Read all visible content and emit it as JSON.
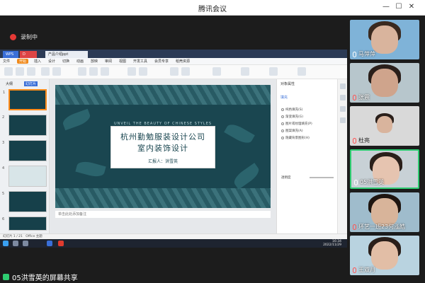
{
  "window": {
    "title": "腾讯会议",
    "minimize": "—",
    "maximize": "☐",
    "close": "✕"
  },
  "recording": {
    "label": "录制中",
    "color": "#e53935"
  },
  "shared_app": {
    "tabs": [
      "WPS",
      "D",
      "产品介绍ppt"
    ],
    "menu": [
      "文件",
      "开始",
      "插入",
      "设计",
      "切换",
      "动画",
      "放映",
      "审阅",
      "视图",
      "开发工具",
      "会员专享",
      "稻壳资源"
    ],
    "active_menu": "开始",
    "thumb_tabs": [
      "大纲",
      "幻灯片"
    ],
    "thumb_numbers": [
      "1",
      "2",
      "3",
      "4",
      "5",
      "6"
    ],
    "slide": {
      "subtitle": "UNVEIL THE BEAUTY OF CHINESE STYLES",
      "line1": "杭州勤勉服装设计公司",
      "line2": "室内装饰设计",
      "presenter": "汇报人：洪雪英"
    },
    "notes_placeholder": "单击此处添加备注",
    "right_panel": {
      "header": "对象属性",
      "tab": "填充",
      "options": [
        "纯色填充(S)",
        "渐变填充(G)",
        "图片或纹理填充(P)",
        "图案填充(A)",
        "隐藏背景图形(H)"
      ],
      "transparency_label": "透明度"
    },
    "status_left": "幻灯片 1 / 21",
    "status_theme": "Office 主题",
    "clock_time": "16:34",
    "clock_date": "2022/11/29"
  },
  "participants": [
    {
      "name": "马萍萍",
      "mic": "on"
    },
    {
      "name": "张震",
      "mic": "muted"
    },
    {
      "name": "杜亮",
      "mic": "muted"
    },
    {
      "name": "05洪雪英",
      "mic": "on"
    },
    {
      "name": "环艺一班23何泓皓",
      "mic": "muted"
    },
    {
      "name": "王双月",
      "mic": "muted"
    }
  ],
  "bottom": {
    "label": "05洪雪英的屏幕共享"
  }
}
